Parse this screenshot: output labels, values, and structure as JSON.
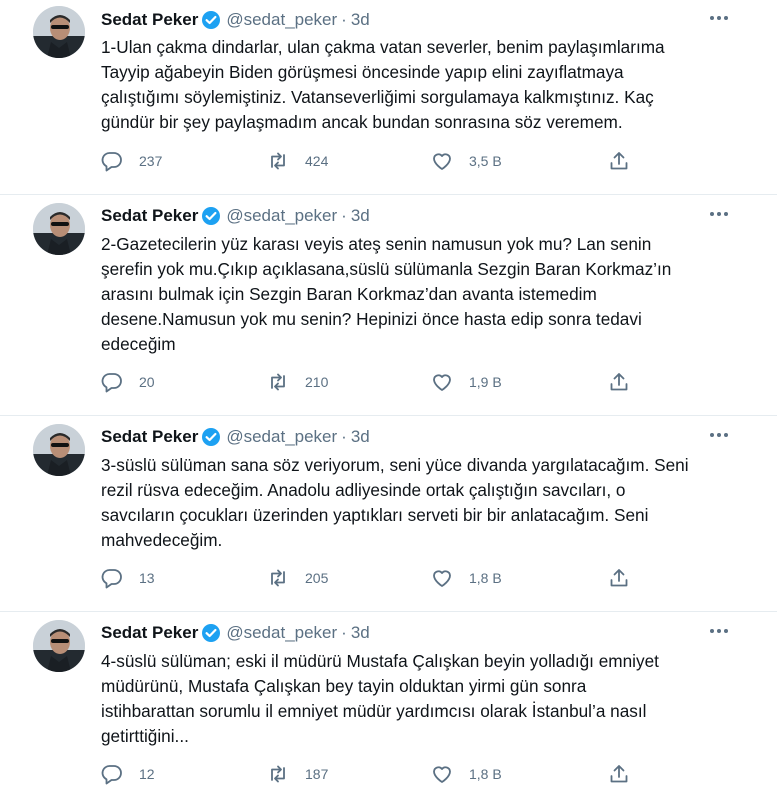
{
  "author": {
    "name": "Sedat Peker",
    "handle": "@sedat_peker",
    "separator": "·",
    "verified_color": "#1da1f2"
  },
  "colors": {
    "text": "#0f1419",
    "muted": "#5b7083",
    "divider": "#e6ecf0"
  },
  "tweets": [
    {
      "time": "3d",
      "text": "1-Ulan çakma dindarlar, ulan çakma vatan severler, benim paylaşımlarıma\nTayyip ağabeyin Biden görüşmesi öncesinde yapıp elini zayıflatmaya\nçalıştığımı söylemiştiniz. Vatanseverliğimi sorgulamaya kalkmıştınız. Kaç\ngündür bir şey paylaşmadım ancak bundan sonrasına söz veremem.",
      "replies": "237",
      "retweets": "424",
      "likes": "3,5 B"
    },
    {
      "time": "3d",
      "text": "2-Gazetecilerin yüz karası veyis ateş senin namusun yok mu? Lan senin\nşerefin yok mu.Çıkıp açıklasana,süslü sülümanla Sezgin Baran Korkmaz’ın\narasını bulmak için Sezgin Baran Korkmaz’dan avanta istemedim\ndesene.Namusun yok mu senin? Hepinizi önce hasta edip sonra tedavi\nedeceğim",
      "replies": "20",
      "retweets": "210",
      "likes": "1,9 B"
    },
    {
      "time": "3d",
      "text": "3-süslü sülüman sana söz veriyorum, seni yüce divanda yargılatacağım. Seni\nrezil rüsva edeceğim. Anadolu adliyesinde ortak çalıştığın savcıları, o\nsavcıların çocukları üzerinden yaptıkları serveti bir bir anlatacağım. Seni\nmahvedeceğim.",
      "replies": "13",
      "retweets": "205",
      "likes": "1,8 B"
    },
    {
      "time": "3d",
      "text": "4-süslü sülüman; eski il müdürü Mustafa Çalışkan beyin yolladığı emniyet\nmüdürünü, Mustafa Çalışkan bey tayin olduktan yirmi gün sonra\nistihbarattan sorumlu il emniyet müdür yardımcısı olarak İstanbul’a nasıl\ngetirttiğini...",
      "replies": "12",
      "retweets": "187",
      "likes": "1,8 B"
    }
  ]
}
